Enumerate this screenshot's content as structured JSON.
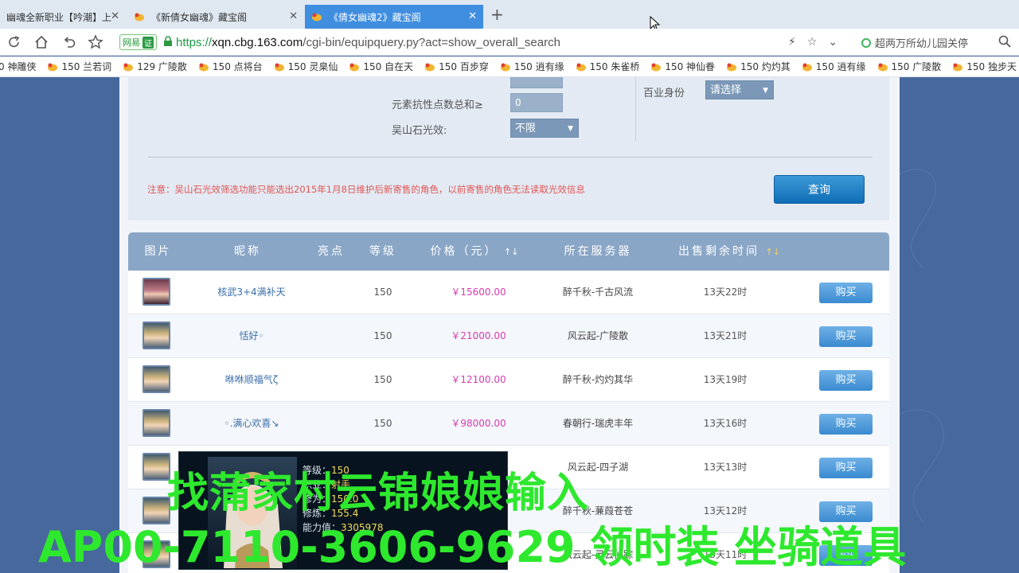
{
  "browser": {
    "tabs": [
      {
        "label": "幽魂全新职业【吟潮】上",
        "active": false
      },
      {
        "label": "《新倩女幽魂》藏宝阁",
        "active": false
      },
      {
        "label": "《倩女幽魂2》藏宝阁",
        "active": true
      }
    ],
    "new_tab_label": "+",
    "url_badge": {
      "text": "网易",
      "glyph": "证"
    },
    "url": {
      "scheme": "https://",
      "host": "xqn.cbg.163.com",
      "path": "/cgi-bin/equipquery.py?act=show_overall_search"
    },
    "search_hint": "超两万所幼儿园关停",
    "bookmarks": [
      "0 神雕侠",
      "150 兰若词",
      "129 广陵散",
      "150 点将台",
      "150 灵臬仙",
      "150 自在天",
      "150 百步穿",
      "150 逍有缘",
      "150 朱雀桥",
      "150 神仙眷",
      "150 灼灼其",
      "150 逍有缘",
      "150 广陵散",
      "150 独步天",
      "15"
    ]
  },
  "form": {
    "fields": [
      {
        "label": "元素抗性点数总和≥",
        "value": "0"
      },
      {
        "label": "吴山石光效:",
        "value": "不限"
      }
    ],
    "identity": {
      "label": "百业身份",
      "value": "请选择"
    },
    "notice": "注意：吴山石光效筛选功能只能选出2015年1月8日维护后新寄售的角色，以前寄售的角色无法读取光效信息",
    "query_button": "查询"
  },
  "table": {
    "headers": {
      "image": "图片",
      "nickname": "昵称",
      "highlight": "亮点",
      "level": "等级",
      "price": "价格（元）",
      "price_sort": "↑↓",
      "server": "所在服务器",
      "time": "出售剩余时间",
      "time_sort": "↑↓"
    },
    "buy_label": "购买",
    "rows": [
      {
        "name": "核武3+4满补天",
        "level": "150",
        "price": "￥15600.00",
        "server": "醉千秋-千古风流",
        "time": "13天22时"
      },
      {
        "name": "恬好◦",
        "level": "150",
        "price": "￥21000.00",
        "server": "风云起-广陵散",
        "time": "13天21时"
      },
      {
        "name": "咻咻顺福气ζ",
        "level": "150",
        "price": "￥12100.00",
        "server": "醉千秋-灼灼其华",
        "time": "13天19时"
      },
      {
        "name": "◦.满心欢喜↘",
        "level": "150",
        "price": "￥98000.00",
        "server": "春朝行-瑞虎丰年",
        "time": "13天16时"
      },
      {
        "name": "",
        "level": "",
        "price": "",
        "server": "风云起-四子湖",
        "time": "13天13时"
      },
      {
        "name": "",
        "level": "",
        "price": "",
        "server": "醉千秋-蒹葭苍苍",
        "time": "13天12时"
      },
      {
        "name": "",
        "level": "",
        "price": "",
        "server": "风云起-灵云仙踪",
        "time": "13天11时"
      }
    ]
  },
  "popup": {
    "lines": [
      {
        "label": "等级：",
        "value": "150"
      },
      {
        "label": "职业：",
        "value": "射手"
      },
      {
        "label": "修为：",
        "value": "150.0"
      },
      {
        "label": "修炼：",
        "value": "155.4"
      },
      {
        "label": "能力值：",
        "value": "3305978"
      }
    ]
  },
  "overlay": {
    "line1": "找蒲家村云锦娘娘输入",
    "line2": "AP00-7110-3606-9629 领时装 坐骑道具"
  },
  "colors": {
    "accent_tab": "#3f8ee0",
    "price": "#d63cb0",
    "notice": "#e05656",
    "overlay_text": "#2ee82e"
  }
}
